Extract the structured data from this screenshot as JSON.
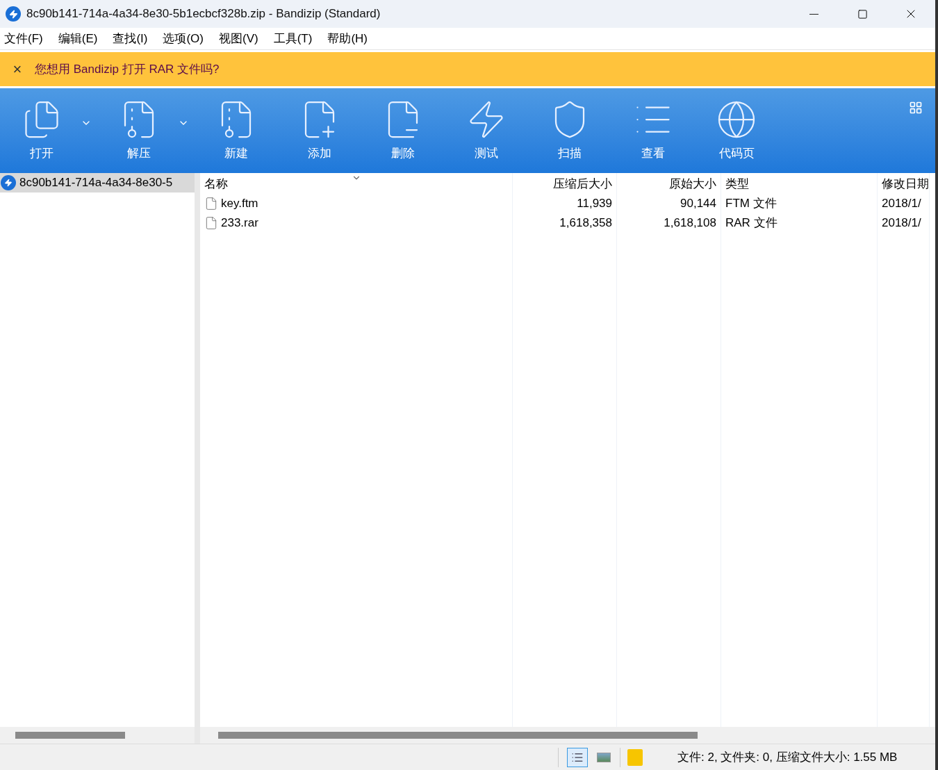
{
  "window": {
    "title": "8c90b141-714a-4a34-8e30-5b1ecbcf328b.zip - Bandizip (Standard)"
  },
  "menu": [
    "文件(F)",
    "编辑(E)",
    "查找(I)",
    "选项(O)",
    "视图(V)",
    "工具(T)",
    "帮助(H)"
  ],
  "notice": {
    "close": "×",
    "text": "您想用 Bandizip 打开 RAR 文件吗?"
  },
  "toolbar": [
    {
      "label": "打开",
      "dropdown": true
    },
    {
      "label": "解压",
      "dropdown": true
    },
    {
      "label": "新建",
      "dropdown": false
    },
    {
      "label": "添加",
      "dropdown": false
    },
    {
      "label": "删除",
      "dropdown": false
    },
    {
      "label": "测试",
      "dropdown": false
    },
    {
      "label": "扫描",
      "dropdown": false
    },
    {
      "label": "查看",
      "dropdown": false
    },
    {
      "label": "代码页",
      "dropdown": false
    }
  ],
  "tree": [
    {
      "label": "8c90b141-714a-4a34-8e30-5",
      "selected": true
    }
  ],
  "table": {
    "columns": [
      "名称",
      "压缩后大小",
      "原始大小",
      "类型",
      "修改日期"
    ],
    "rows": [
      [
        "key.ftm",
        "11,939",
        "90,144",
        "FTM 文件",
        "2018/1/"
      ],
      [
        "233.rar",
        "1,618,358",
        "1,618,108",
        "RAR 文件",
        "2018/1/"
      ]
    ]
  },
  "status_bar": {
    "views": [
      {
        "kind": "details",
        "selected": true
      },
      {
        "kind": "preview",
        "selected": false
      }
    ],
    "text": "文件: 2, 文件夹: 0, 压缩文件大小: 1.55 MB"
  }
}
